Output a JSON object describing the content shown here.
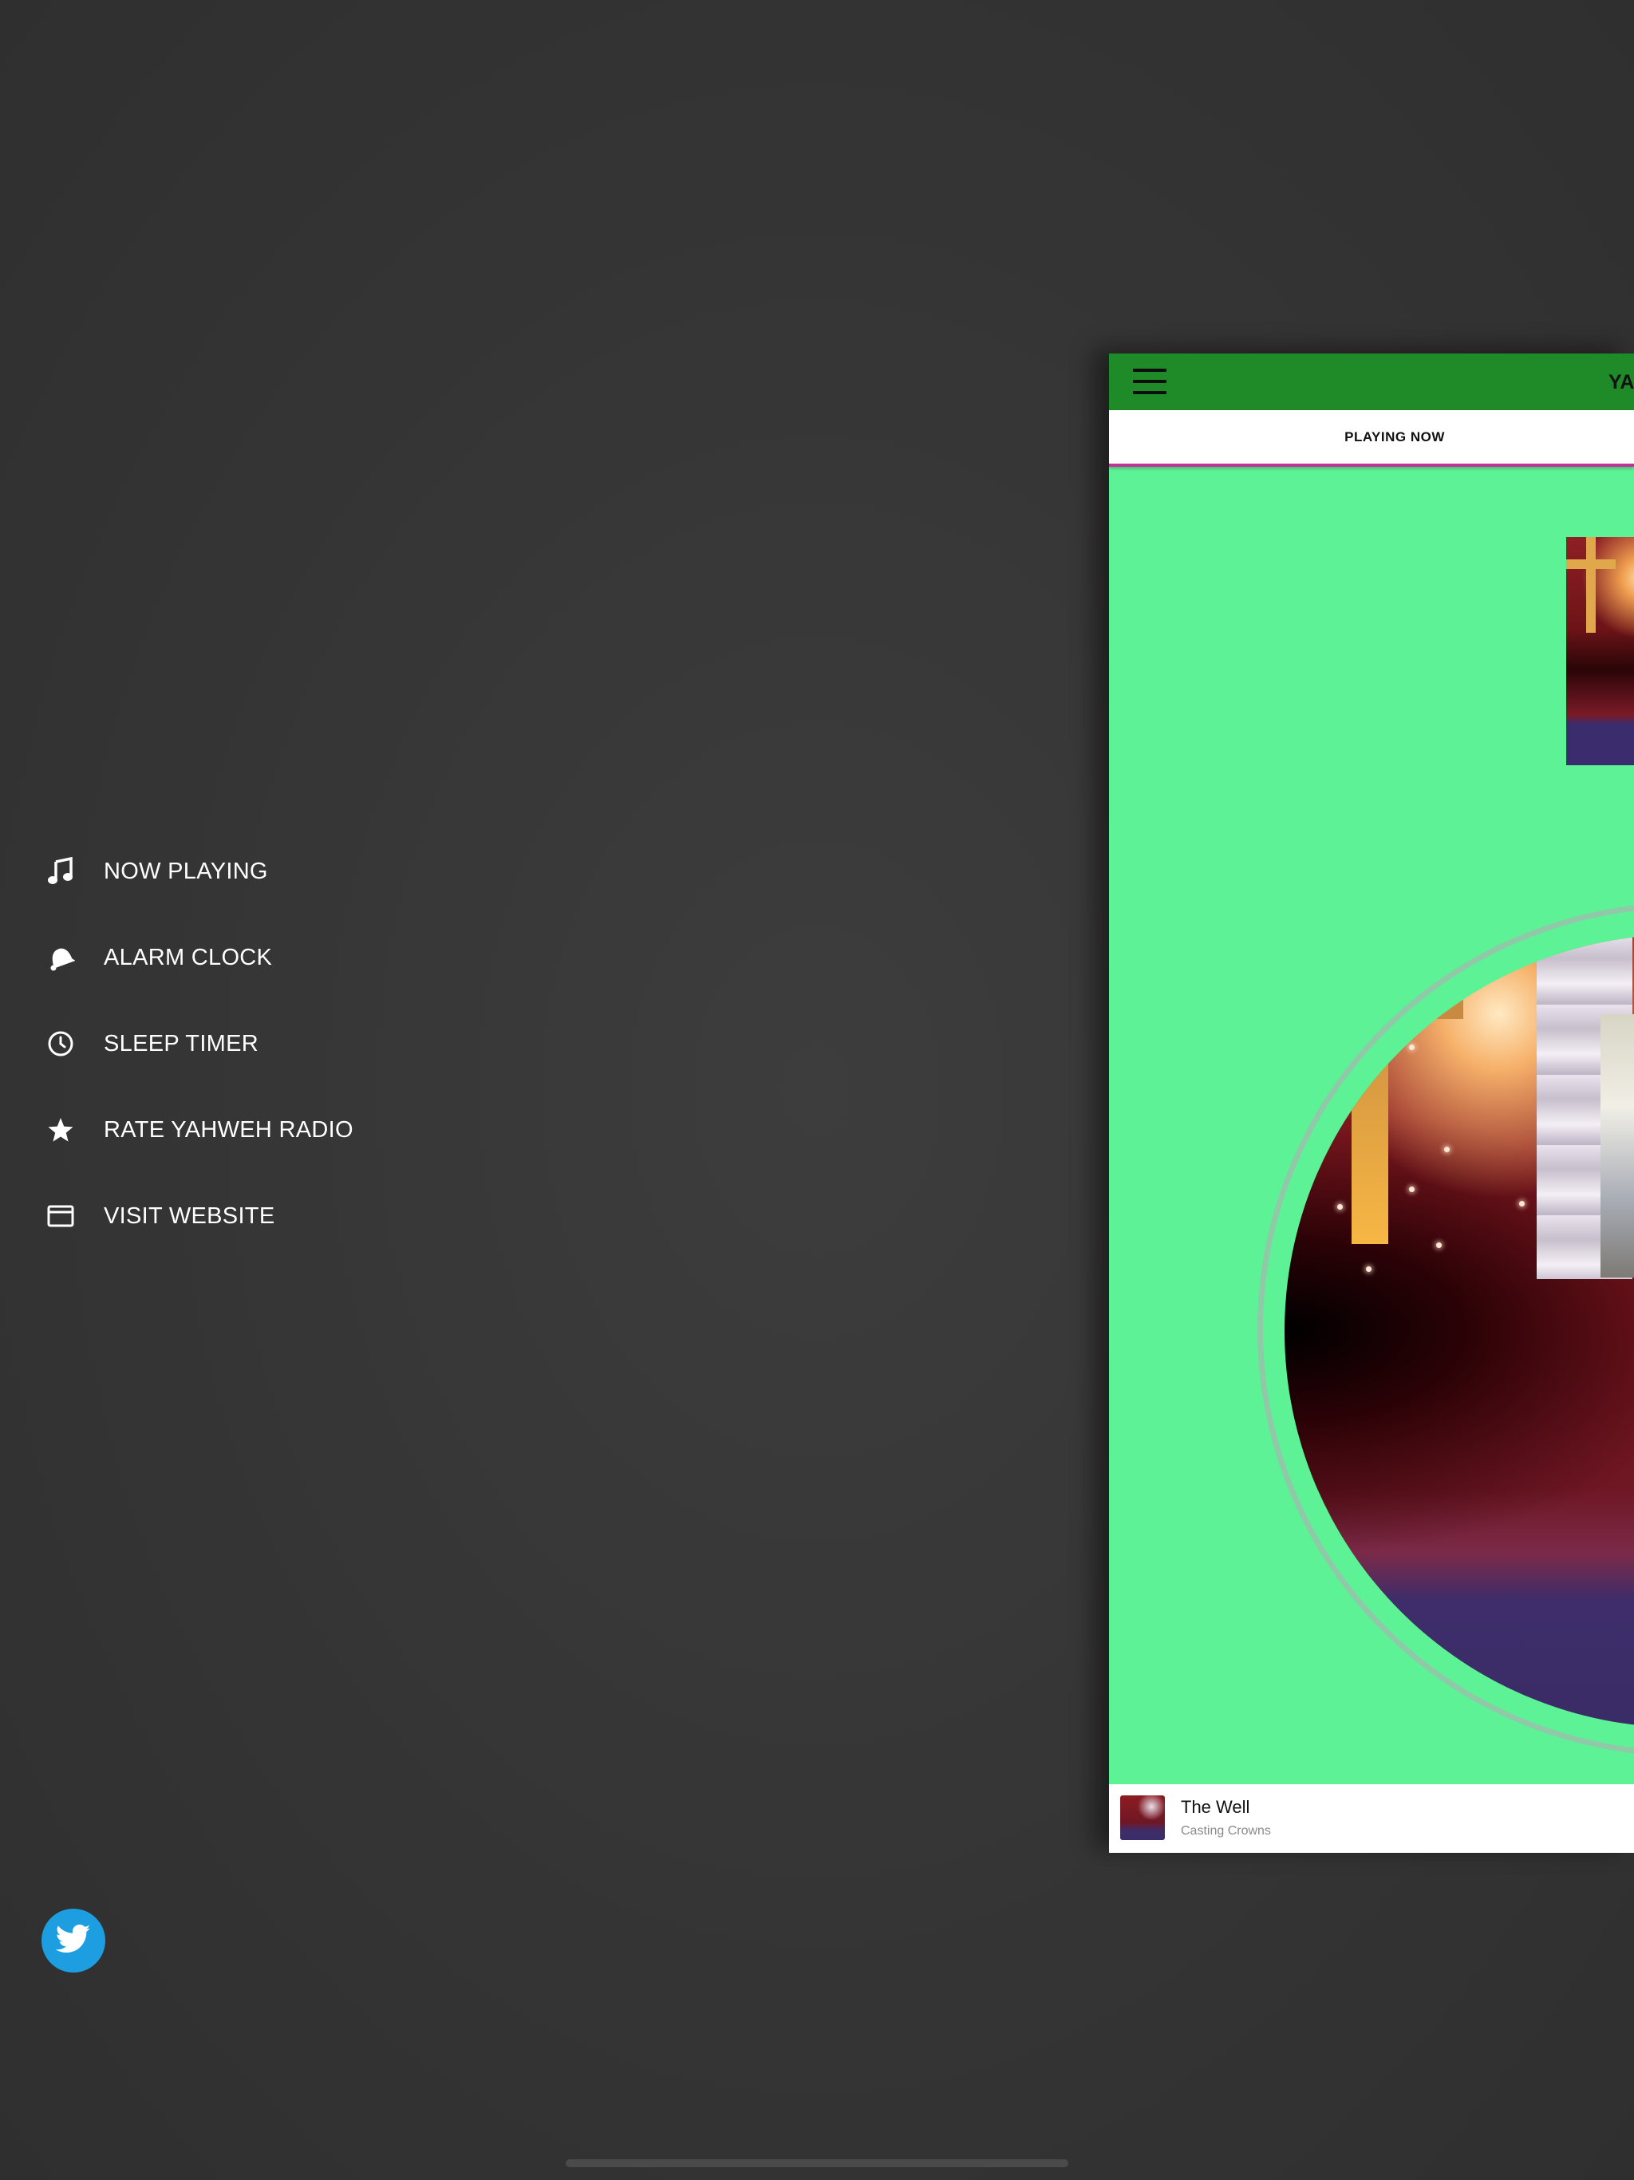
{
  "menu": {
    "items": [
      {
        "label": "NOW PLAYING",
        "icon": "music-note-icon"
      },
      {
        "label": "ALARM CLOCK",
        "icon": "alarm-bell-icon"
      },
      {
        "label": "SLEEP TIMER",
        "icon": "clock-icon"
      },
      {
        "label": "RATE YAHWEH RADIO",
        "icon": "star-icon"
      },
      {
        "label": "VISIT WEBSITE",
        "icon": "browser-window-icon"
      }
    ]
  },
  "social": {
    "twitter_icon": "twitter-bird-icon",
    "twitter_color": "#1d9ee0"
  },
  "app": {
    "title": "YA",
    "tab_label": "PLAYING NOW",
    "header_color": "#1e8a28",
    "background_color": "#5ef296",
    "tab_indicator_color": "#c2309a"
  },
  "player": {
    "track_title": "The Well",
    "artist": "Casting Crowns"
  }
}
